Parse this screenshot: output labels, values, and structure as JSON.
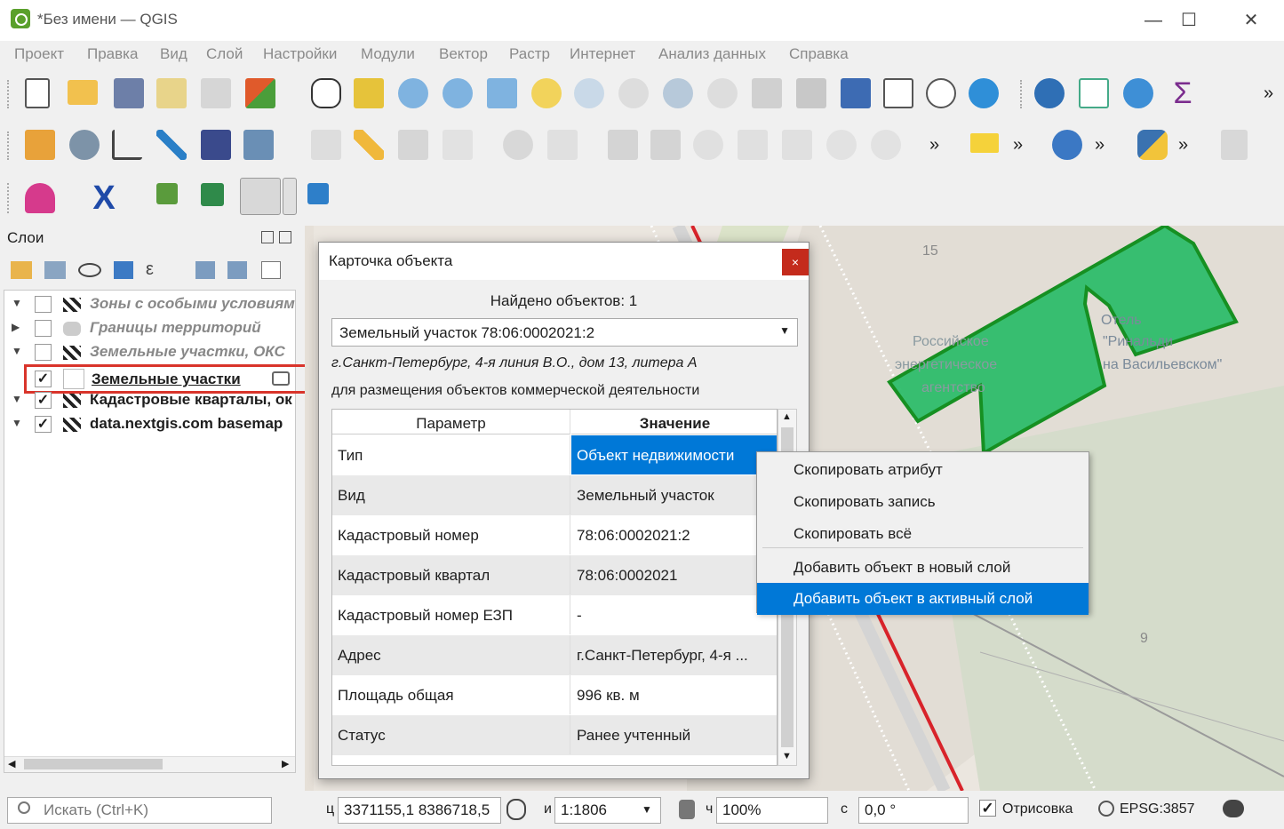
{
  "window": {
    "title": "*Без имени — QGIS",
    "minimize": "—",
    "maximize": "☐",
    "close": "✕"
  },
  "menu": [
    "Проект",
    "Правка",
    "Вид",
    "Слой",
    "Настройки",
    "Модули",
    "Вектор",
    "Растр",
    "Интернет",
    "Анализ данных",
    "Справка"
  ],
  "toolbar": {
    "overflow": "»"
  },
  "layers_panel": {
    "title": "Слои",
    "items": [
      {
        "label": "Зоны с особыми условиям",
        "checked": false,
        "expanded": true,
        "style": "gray"
      },
      {
        "label": "Границы территорий",
        "checked": false,
        "expanded": false,
        "style": "gray"
      },
      {
        "label": "Земельные участки, ОКС",
        "checked": false,
        "expanded": true,
        "style": "gray"
      },
      {
        "label": "Земельные участки",
        "checked": true,
        "expanded": null,
        "style": "active"
      },
      {
        "label": "Кадастровые кварталы, ок",
        "checked": true,
        "expanded": true,
        "style": "black"
      },
      {
        "label": "data.nextgis.com basemap",
        "checked": true,
        "expanded": true,
        "style": "black"
      }
    ]
  },
  "map": {
    "labels": [
      "15",
      "Отель",
      "\"Ринальди",
      "на Васильевском\"",
      "Российское",
      "энергетическое",
      "агентство",
      "9"
    ]
  },
  "identify": {
    "title": "Карточка объекта",
    "close": "×",
    "found": "Найдено объектов: 1",
    "selected": "Земельный участок 78:06:0002021:2",
    "address": "г.Санкт-Петербург, 4-я линия В.О., дом 13, литера А",
    "purpose": "для размещения объектов коммерческой деятельности",
    "columns": [
      "Параметр",
      "Значение"
    ],
    "rows": [
      {
        "param": "Тип",
        "value": "Объект недвижимости"
      },
      {
        "param": "Вид",
        "value": "Земельный участок"
      },
      {
        "param": "Кадастровый номер",
        "value": "78:06:0002021:2"
      },
      {
        "param": "Кадастровый квартал",
        "value": "78:06:0002021"
      },
      {
        "param": "Кадастровый номер ЕЗП",
        "value": "-"
      },
      {
        "param": "Адрес",
        "value": "г.Санкт-Петербург, 4-я ..."
      },
      {
        "param": "Площадь общая",
        "value": "996 кв. м"
      },
      {
        "param": "Статус",
        "value": "Ранее учтенный"
      }
    ]
  },
  "context_menu": [
    "Скопировать атрибут",
    "Скопировать запись",
    "Скопировать всё",
    "Добавить объект в новый слой",
    "Добавить объект в активный слой"
  ],
  "status": {
    "search_placeholder": "Искать (Ctrl+K)",
    "coord_label": "ц",
    "coord": "3371155,1  8386718,5",
    "scale_label": "и",
    "scale": "1:1806",
    "zoom_label": "ч",
    "zoom": "100%",
    "rot_label": "с",
    "rotation": "0,0 °",
    "render": "Отрисовка",
    "crs": "EPSG:3857"
  },
  "colors": {
    "accent": "#0078d7",
    "green_fill": "#2ebd6b",
    "highlight_border": "#d9342b"
  }
}
